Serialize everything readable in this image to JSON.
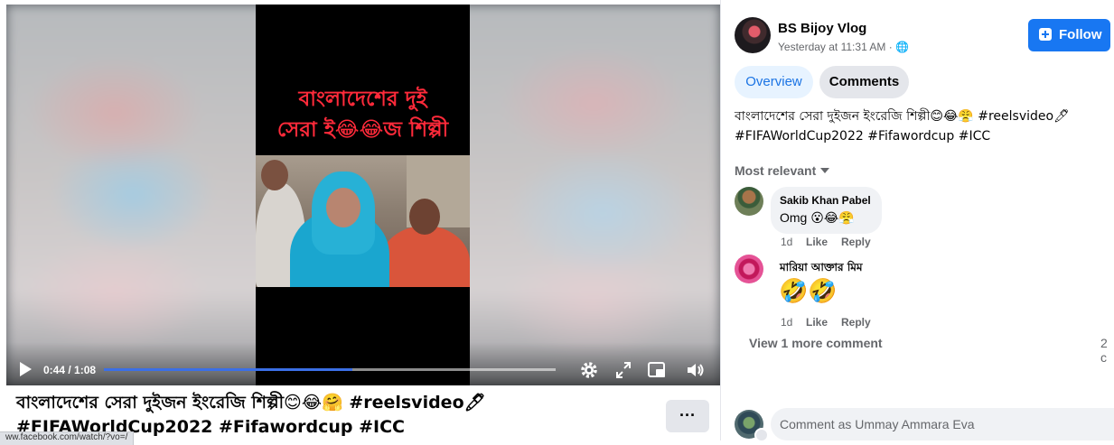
{
  "video": {
    "caption_line1": "বাংলাদেশের দুই",
    "caption_line2": "সেরা ই😂😂জ শিল্পী",
    "time_display": "0:44 / 1:08",
    "progress": 0.55
  },
  "post": {
    "title_line1": "বাংলাদেশের সেরা দুইজন ইংরেজি শিল্পী😊😂🤗 #reelsvideo🖊",
    "title_line2": "#FIFAWorldCup2022 #Fifawordcup #ICC",
    "more_label": "···",
    "status_url": "ww.facebook.com/watch/?vo=/"
  },
  "panel": {
    "page_name": "BS Bijoy Vlog",
    "timestamp": "Yesterday at 11:31 AM · 🌐",
    "follow_label": "Follow",
    "tabs": [
      {
        "label": "Overview"
      },
      {
        "label": "Comments"
      }
    ],
    "desc_line1": "বাংলাদেশের সেরা দুইজন ইংরেজি শিল্পী😊😂😤 #reelsvideo🖊",
    "desc_line2": "#FIFAWorldCup2022 #Fifawordcup #ICC",
    "sort_label": "Most relevant",
    "comments": [
      {
        "author": "Sakib Khan Pabel",
        "text": "Omg 😮😂😤",
        "age": "1d",
        "like": "Like",
        "reply": "Reply"
      },
      {
        "author": "মারিয়া আক্তার মিম",
        "text": "🤣🤣",
        "age": "1d",
        "like": "Like",
        "reply": "Reply"
      }
    ],
    "view_more": "View 1 more comment",
    "count_cut": "2 c",
    "comment_placeholder": "Comment as Ummay Ammara Eva"
  },
  "colors": {
    "accent": "#1877f2",
    "progress": "#3b6fe6",
    "caption_red": "#ff2a3a"
  }
}
